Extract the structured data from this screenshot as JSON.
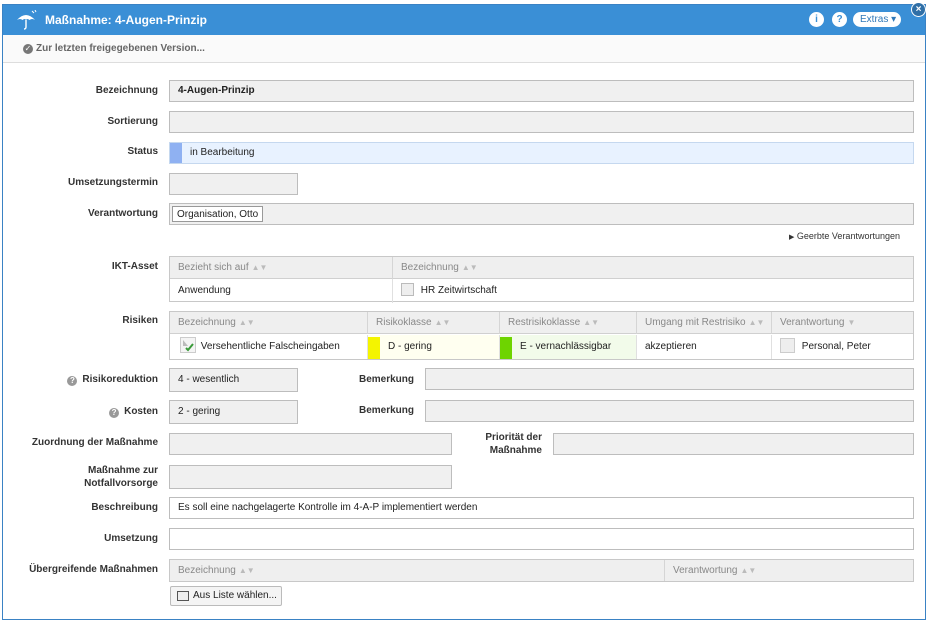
{
  "dialog": {
    "title": "Maßnahme: 4-Augen-Prinzip",
    "info_icon": "i",
    "help_icon": "?",
    "extras_label": "Extras ▾",
    "close_icon": "×",
    "version_link": "Zur letzten freigegebenen Version..."
  },
  "form": {
    "bezeichnung_label": "Bezeichnung",
    "bezeichnung_value": "4-Augen-Prinzip",
    "sortierung_label": "Sortierung",
    "sortierung_value": "",
    "status_label": "Status",
    "status_value": "in Bearbeitung",
    "umsetzungstermin_label": "Umsetzungstermin",
    "umsetzungstermin_value": "",
    "verantwortung_label": "Verantwortung",
    "verantwortung_value": "Organisation, Otto",
    "geerbte_link": "Geerbte Verantwortungen",
    "ikt_label": "IKT-Asset",
    "risiken_label": "Risiken",
    "risikoreduktion_label": "Risikoreduktion",
    "risikoreduktion_value": "4 - wesentlich",
    "bemerkung1_label": "Bemerkung",
    "bemerkung1_value": "",
    "kosten_label": "Kosten",
    "kosten_value": "2 - gering",
    "bemerkung2_label": "Bemerkung",
    "bemerkung2_value": "",
    "zuordnung_label": "Zuordnung der Maßnahme",
    "prioritaet_label_1": "Priorität der",
    "prioritaet_label_2": "Maßnahme",
    "notfall_label_1": "Maßnahme zur",
    "notfall_label_2": "Notfallvorsorge",
    "beschreibung_label": "Beschreibung",
    "beschreibung_value": "Es soll eine nachgelagerte Kontrolle im 4-A-P implementiert werden",
    "umsetzung_label": "Umsetzung",
    "umsetzung_value": "",
    "uebergreifend_label": "Übergreifende Maßnahmen",
    "aus_liste_button": "Aus Liste wählen..."
  },
  "ikt_table": {
    "headers": [
      "Bezieht sich auf",
      "Bezeichnung"
    ],
    "rows": [
      [
        "Anwendung",
        "HR Zeitwirtschaft"
      ]
    ]
  },
  "risiken_table": {
    "headers": [
      "Bezeichnung",
      "Risikoklasse",
      "Restrisikoklasse",
      "Umgang mit Restrisiko",
      "Verantwortung"
    ],
    "rows": [
      [
        "Versehentliche Falscheingaben",
        "D - gering",
        "E - vernachlässigbar",
        "akzeptieren",
        "Personal, Peter"
      ]
    ]
  },
  "uebergreifend_table": {
    "headers": [
      "Bezeichnung",
      "Verantwortung"
    ]
  },
  "colors": {
    "titlebar": "#3a8fd6",
    "status_marker": "#8fb1f2",
    "status_bg": "#e8f2ff",
    "risk_d": "#f4f400",
    "risk_e": "#6ed400"
  }
}
